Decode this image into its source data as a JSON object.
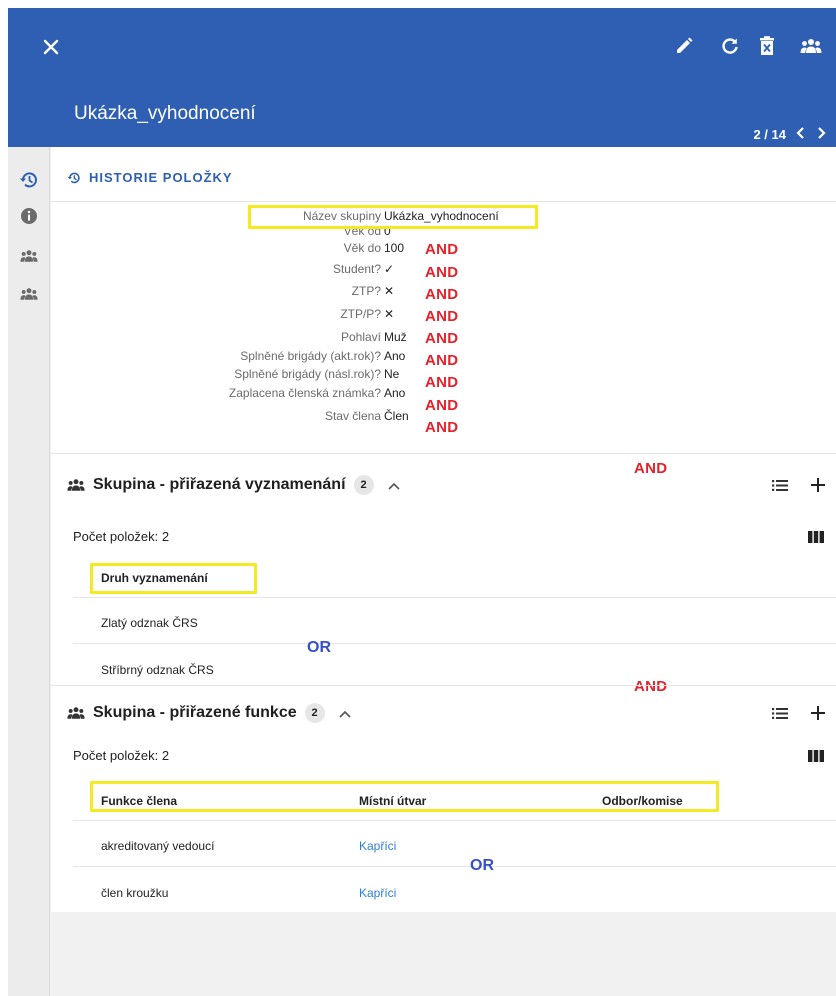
{
  "header": {
    "title": "Ukázka_vyhodnocení",
    "pager": {
      "current": "2",
      "total": "14",
      "text": "2 / 14"
    },
    "color": "#2e5fb3",
    "actions": [
      "close-icon",
      "edit-icon",
      "refresh-icon",
      "delete-icon",
      "group-icon"
    ]
  },
  "rail": {
    "items": [
      "history-icon",
      "info-icon",
      "group-icon",
      "group-icon"
    ]
  },
  "history": {
    "title": "HISTORIE POLOŽKY",
    "fields": [
      {
        "label": "Název skupiny",
        "value": "Ukázka_vyhodnocení"
      },
      {
        "label": "Věk od",
        "value": "0"
      },
      {
        "label": "Věk do",
        "value": "100"
      },
      {
        "label": "Student?",
        "value": "✓"
      },
      {
        "label": "ZTP?",
        "value": "✕"
      },
      {
        "label": "ZTP/P?",
        "value": "✕"
      },
      {
        "label": "Pohlaví",
        "value": "Muž"
      },
      {
        "label": "Splněné brigády (akt.rok)?",
        "value": "Ano"
      },
      {
        "label": "Splněné brigády (násl.rok)?",
        "value": "Ne"
      },
      {
        "label": "Zaplacena členská známka?",
        "value": "Ano"
      },
      {
        "label": "Stav člena",
        "value": "Člen"
      }
    ]
  },
  "annotations": {
    "and_label": "AND",
    "or_label": "OR",
    "highlight_color": "#f3ea21",
    "and_color": "#e5212b",
    "or_color": "#3750c7"
  },
  "section_awards": {
    "title": "Skupina - přiřazená vyznamenání",
    "badge": "2",
    "count_label": "Počet položek: 2",
    "header": "Druh vyznamenání",
    "rows": [
      "Zlatý odznak ČRS",
      "Stříbrný odznak ČRS"
    ]
  },
  "section_functions": {
    "title": "Skupina - přiřazené funkce",
    "badge": "2",
    "count_label": "Počet položek: 2",
    "headers": [
      "Funkce člena",
      "Místní útvar",
      "Odbor/komise"
    ],
    "rows": [
      {
        "function": "akreditovaný vedoucí",
        "unit": "Kapříci",
        "committee": ""
      },
      {
        "function": "člen kroužku",
        "unit": "Kapříci",
        "committee": ""
      }
    ]
  }
}
